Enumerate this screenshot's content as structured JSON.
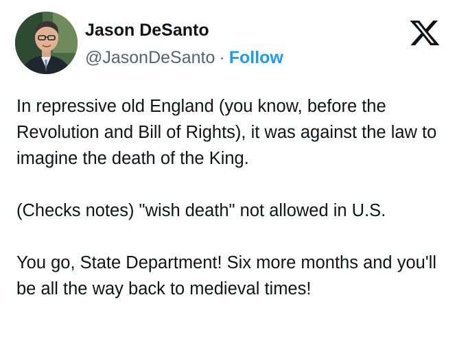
{
  "author": {
    "display_name": "Jason DeSanto",
    "handle": "@JasonDeSanto",
    "separator": "·",
    "follow_label": "Follow"
  },
  "logo": {
    "icon": "x-logo-icon"
  },
  "tweet": {
    "paragraphs": [
      "In repressive old England (you know, before the Revolution and Bill of Rights), it was against the law to imagine the death of the King.",
      "(Checks notes) \"wish death\" not allowed in U.S.",
      "You go, State Department! Six more months and you'll be all the way back to medieval times!"
    ]
  },
  "colors": {
    "text": "#0f1419",
    "secondary": "#536471",
    "accent": "#1d9bf0"
  }
}
